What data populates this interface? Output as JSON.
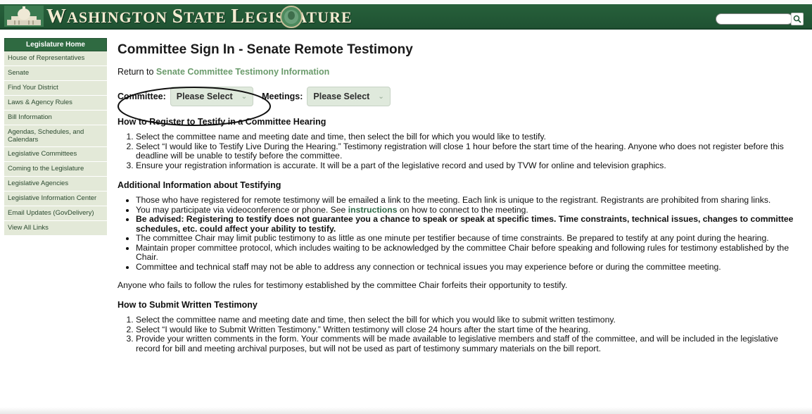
{
  "header": {
    "title_first_letter": "W",
    "title_rest": "ashington",
    "title_word2_first": "S",
    "title_word2_rest": "tate",
    "title_word3_first": "L",
    "title_word3_rest": "egislature",
    "colors": {
      "header_bg": "#27603b",
      "title_text": "#f3ecd2"
    },
    "search_placeholder": ""
  },
  "sidebar": {
    "home_label": "Legislature Home",
    "items": [
      {
        "label": "House of Representatives"
      },
      {
        "label": "Senate"
      },
      {
        "label": "Find Your District"
      },
      {
        "label": "Laws & Agency Rules"
      },
      {
        "label": "Bill Information"
      },
      {
        "label": "Agendas, Schedules, and Calendars"
      },
      {
        "label": "Legislative Committees"
      },
      {
        "label": "Coming to the Legislature"
      },
      {
        "label": "Legislative Agencies"
      },
      {
        "label": "Legislative Information Center"
      },
      {
        "label": "Email Updates (GovDelivery)"
      },
      {
        "label": "View All Links"
      }
    ]
  },
  "main": {
    "title": "Committee Sign In - Senate Remote Testimony",
    "return_prefix": "Return to",
    "return_link": "Senate Committee Testimony Information",
    "committee_label": "Committee:",
    "committee_value": "Please Select",
    "meetings_label": "Meetings:",
    "meetings_value": "Please Select",
    "register_heading": "How to Register to Testify in a Committee Hearing",
    "register_steps": [
      "Select the committee name and meeting date and time, then select the bill for which you would like to testify.",
      "Select “I would like to Testify Live During the Hearing.” Testimony registration will close 1 hour before the start time of the hearing. Anyone who does not register before this deadline will be unable to testify before the committee.",
      "Ensure your registration information is accurate. It will be a part of the legislative record and used by TVW for online and television graphics."
    ],
    "additional_heading": "Additional Information about Testifying",
    "additional_items": {
      "item1": "Those who have registered for remote testimony will be emailed a link to the meeting. Each link is unique to the registrant. Registrants are prohibited from sharing links.",
      "item2_prefix": "You may participate via videoconference or phone. See",
      "item2_link": "instructions",
      "item2_suffix": "on how to connect to the meeting.",
      "item3": "Be advised: Registering to testify does not guarantee you a chance to speak or speak at specific times. Time constraints, technical issues, changes to committee schedules, etc. could affect your ability to testify.",
      "item4": "The committee Chair may limit public testimony to as little as one minute per testifier because of time constraints. Be prepared to testify at any point during the hearing.",
      "item5": "Maintain proper committee protocol, which includes waiting to be acknowledged by the committee Chair before speaking and following rules for testimony established by the Chair.",
      "item6": "Committee and technical staff may not be able to address any connection or technical issues you may experience before or during the committee meeting."
    },
    "forfeit_note": "Anyone who fails to follow the rules for testimony established by the committee Chair forfeits their opportunity to testify.",
    "written_heading": "How to Submit Written Testimony",
    "written_steps": [
      "Select the committee name and meeting date and time, then select the bill for which you would like to submit written testimony.",
      "Select “I would like to Submit Written Testimony.” Written testimony will close 24 hours after the start time of the hearing.",
      "Provide your written comments in the form. Your comments will be made available to legislative members and staff of the committee, and will be included in the legislative record for bill and meeting archival purposes, but will not be used as part of testimony summary materials on the bill report."
    ]
  }
}
